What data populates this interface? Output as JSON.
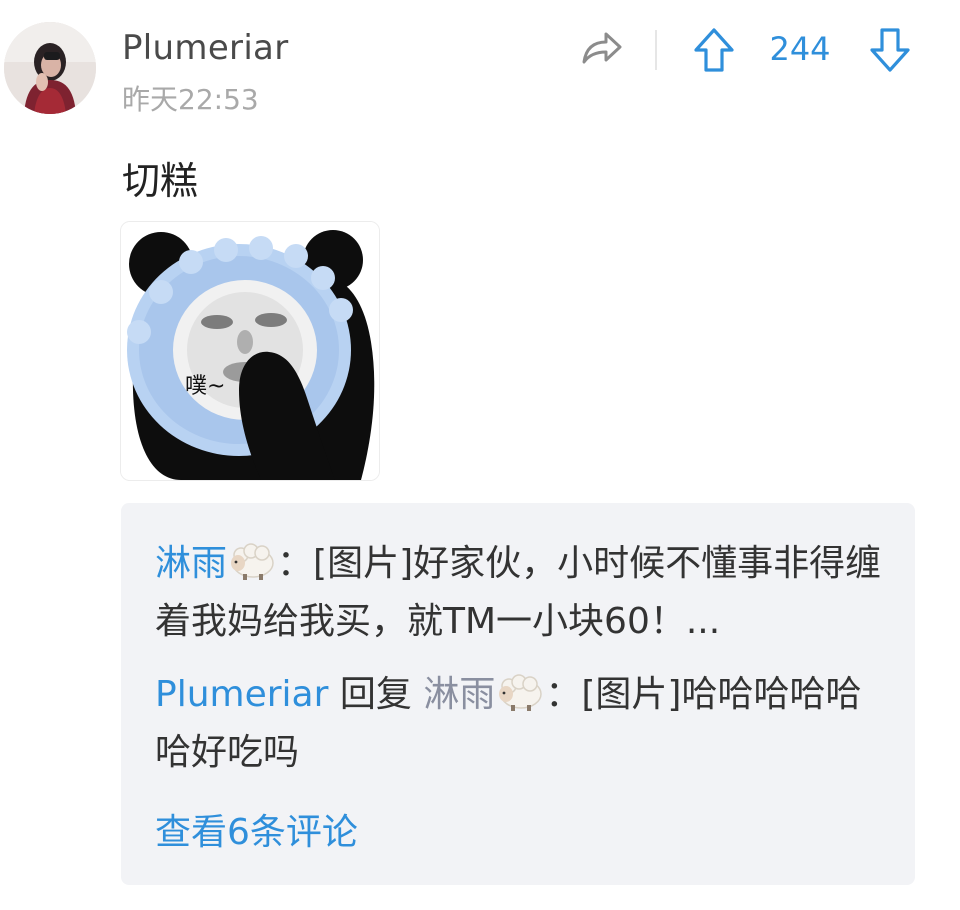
{
  "post": {
    "username": "Plumeriar",
    "timestamp": "昨天22:53",
    "text": "切糕",
    "image_caption": "噗~",
    "vote_count": "244"
  },
  "icons": {
    "share": "share-icon",
    "upvote": "arrow-up-icon",
    "downvote": "arrow-down-icon",
    "sheep_emoji": "sheep-emoji-icon"
  },
  "colors": {
    "accent": "#2f8fdb",
    "comment_bg": "#f2f3f6",
    "timestamp": "#a9a9a9"
  },
  "comments": [
    {
      "author": "淋雨",
      "separator": "：",
      "text": "[图片]好家伙，小时候不懂事非得缠着我妈给我买，就TM一小块60！..."
    },
    {
      "author": "Plumeriar",
      "reply_word": "回复",
      "reply_to": "淋雨",
      "separator": "：",
      "text": "[图片]哈哈哈哈哈哈好吃吗"
    }
  ],
  "view_all_label": "查看6条评论"
}
